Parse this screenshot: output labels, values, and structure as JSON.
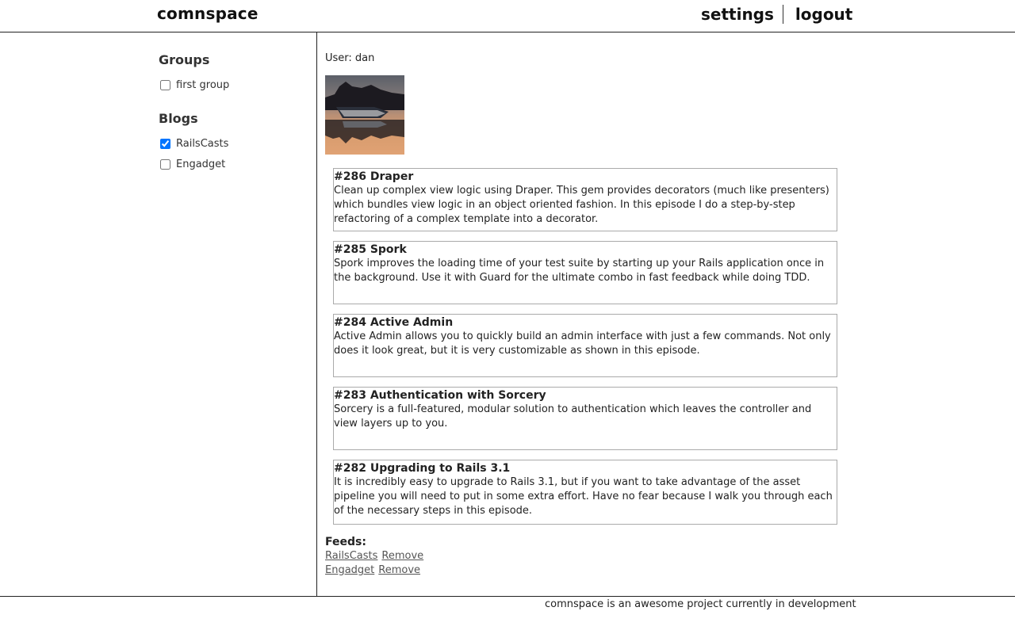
{
  "header": {
    "brand": "comnspace",
    "settings_label": "settings",
    "logout_label": "logout"
  },
  "sidebar": {
    "groups_heading": "Groups",
    "groups": [
      {
        "label": "first group",
        "checked": false
      }
    ],
    "blogs_heading": "Blogs",
    "blogs": [
      {
        "label": "RailsCasts",
        "checked": true
      },
      {
        "label": "Engadget",
        "checked": false
      }
    ]
  },
  "main": {
    "user_label": "User: dan",
    "posts": [
      {
        "title": "#286 Draper",
        "body": "Clean up complex view logic using Draper. This gem provides decorators (much like presenters) which bundles view logic in an object oriented fashion. In this episode I do a step-by-step refactoring of a complex template into a decorator."
      },
      {
        "title": "#285 Spork",
        "body": "Spork improves the loading time of your test suite by starting up your Rails application once in the background. Use it with Guard for the ultimate combo in fast feedback while doing TDD."
      },
      {
        "title": "#284 Active Admin",
        "body": "Active Admin allows you to quickly build an admin interface with just a few commands. Not only does it look great, but it is very customizable as shown in this episode."
      },
      {
        "title": "#283 Authentication with Sorcery",
        "body": "Sorcery is a full-featured, modular solution to authentication which leaves the controller and view layers up to you."
      },
      {
        "title": "#282 Upgrading to Rails 3.1",
        "body": "It is incredibly easy to upgrade to Rails 3.1, but if you want to take advantage of the asset pipeline you will need to put in some extra effort. Have no fear because I walk you through each of the necessary steps in this episode."
      }
    ],
    "feeds_label": "Feeds:",
    "feeds": [
      {
        "name": "RailsCasts",
        "remove_label": "Remove"
      },
      {
        "name": "Engadget",
        "remove_label": "Remove"
      }
    ]
  },
  "footer": {
    "text": "comnspace is an awesome project currently in development"
  }
}
